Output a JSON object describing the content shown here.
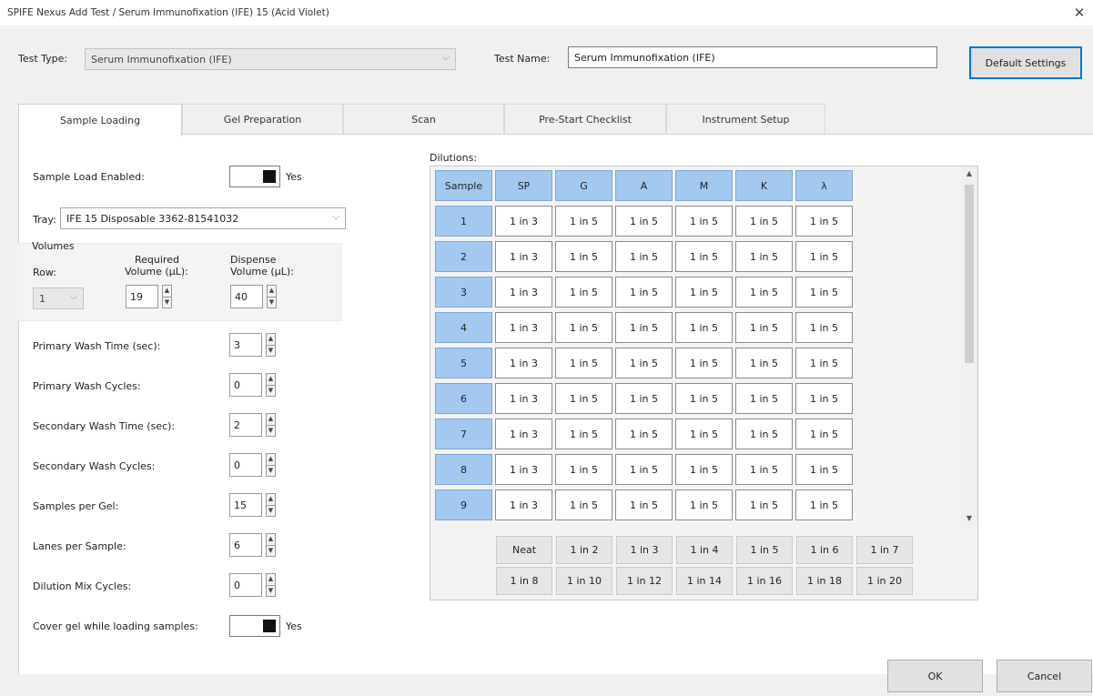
{
  "window": {
    "title": "SPIFE Nexus Add Test / Serum Immunofixation (IFE) 15 (Acid Violet)"
  },
  "header": {
    "test_type_label": "Test Type:",
    "test_type_value": "Serum Immunofixation (IFE)",
    "test_name_label": "Test Name:",
    "test_name_value": "Serum Immunofixation (IFE)",
    "default_settings": "Default Settings"
  },
  "tabs": [
    {
      "label": "Sample Loading",
      "active": true
    },
    {
      "label": "Gel Preparation",
      "active": false
    },
    {
      "label": "Scan",
      "active": false
    },
    {
      "label": "Pre-Start Checklist",
      "active": false
    },
    {
      "label": "Instrument Setup",
      "active": false
    }
  ],
  "sample_loading": {
    "sample_load_enabled_label": "Sample Load Enabled:",
    "sample_load_enabled_value": "Yes",
    "tray_label": "Tray:",
    "tray_value": "IFE 15 Disposable  3362-81541032",
    "volumes": {
      "title": "Volumes",
      "row_label": "Row:",
      "row_value": "1",
      "required_label_1": "Required",
      "required_label_2": "Volume (µL):",
      "required_value": "19",
      "dispense_label_1": "Dispense",
      "dispense_label_2": "Volume (µL):",
      "dispense_value": "40"
    },
    "fields": [
      {
        "label": "Primary Wash Time (sec):",
        "value": "3"
      },
      {
        "label": "Primary Wash Cycles:",
        "value": "0"
      },
      {
        "label": "Secondary Wash Time (sec):",
        "value": "2"
      },
      {
        "label": "Secondary Wash Cycles:",
        "value": "0"
      },
      {
        "label": "Samples per Gel:",
        "value": "15"
      },
      {
        "label": "Lanes per Sample:",
        "value": "6"
      },
      {
        "label": "Dilution Mix Cycles:",
        "value": "0"
      }
    ],
    "cover_gel_label": "Cover gel while loading samples:",
    "cover_gel_value": "Yes"
  },
  "dilutions": {
    "label": "Dilutions:",
    "columns": [
      "Sample",
      "SP",
      "G",
      "A",
      "M",
      "K",
      "λ"
    ],
    "rows": [
      [
        "1",
        "1 in 3",
        "1 in 5",
        "1 in 5",
        "1 in 5",
        "1 in 5",
        "1 in 5"
      ],
      [
        "2",
        "1 in 3",
        "1 in 5",
        "1 in 5",
        "1 in 5",
        "1 in 5",
        "1 in 5"
      ],
      [
        "3",
        "1 in 3",
        "1 in 5",
        "1 in 5",
        "1 in 5",
        "1 in 5",
        "1 in 5"
      ],
      [
        "4",
        "1 in 3",
        "1 in 5",
        "1 in 5",
        "1 in 5",
        "1 in 5",
        "1 in 5"
      ],
      [
        "5",
        "1 in 3",
        "1 in 5",
        "1 in 5",
        "1 in 5",
        "1 in 5",
        "1 in 5"
      ],
      [
        "6",
        "1 in 3",
        "1 in 5",
        "1 in 5",
        "1 in 5",
        "1 in 5",
        "1 in 5"
      ],
      [
        "7",
        "1 in 3",
        "1 in 5",
        "1 in 5",
        "1 in 5",
        "1 in 5",
        "1 in 5"
      ],
      [
        "8",
        "1 in 3",
        "1 in 5",
        "1 in 5",
        "1 in 5",
        "1 in 5",
        "1 in 5"
      ],
      [
        "9",
        "1 in 3",
        "1 in 5",
        "1 in 5",
        "1 in 5",
        "1 in 5",
        "1 in 5"
      ]
    ],
    "preset_buttons": [
      [
        "Neat",
        "1 in 2",
        "1 in 3",
        "1 in 4",
        "1 in 5",
        "1 in 6",
        "1 in 7"
      ],
      [
        "1 in 8",
        "1 in 10",
        "1 in 12",
        "1 in 14",
        "1 in 16",
        "1 in 18",
        "1 in 20"
      ]
    ]
  },
  "footer": {
    "ok": "OK",
    "cancel": "Cancel"
  },
  "colors": {
    "header_cell": "#a3c9f0",
    "default_button_border": "#0078d7",
    "window_bg": "#f0f0f0"
  }
}
